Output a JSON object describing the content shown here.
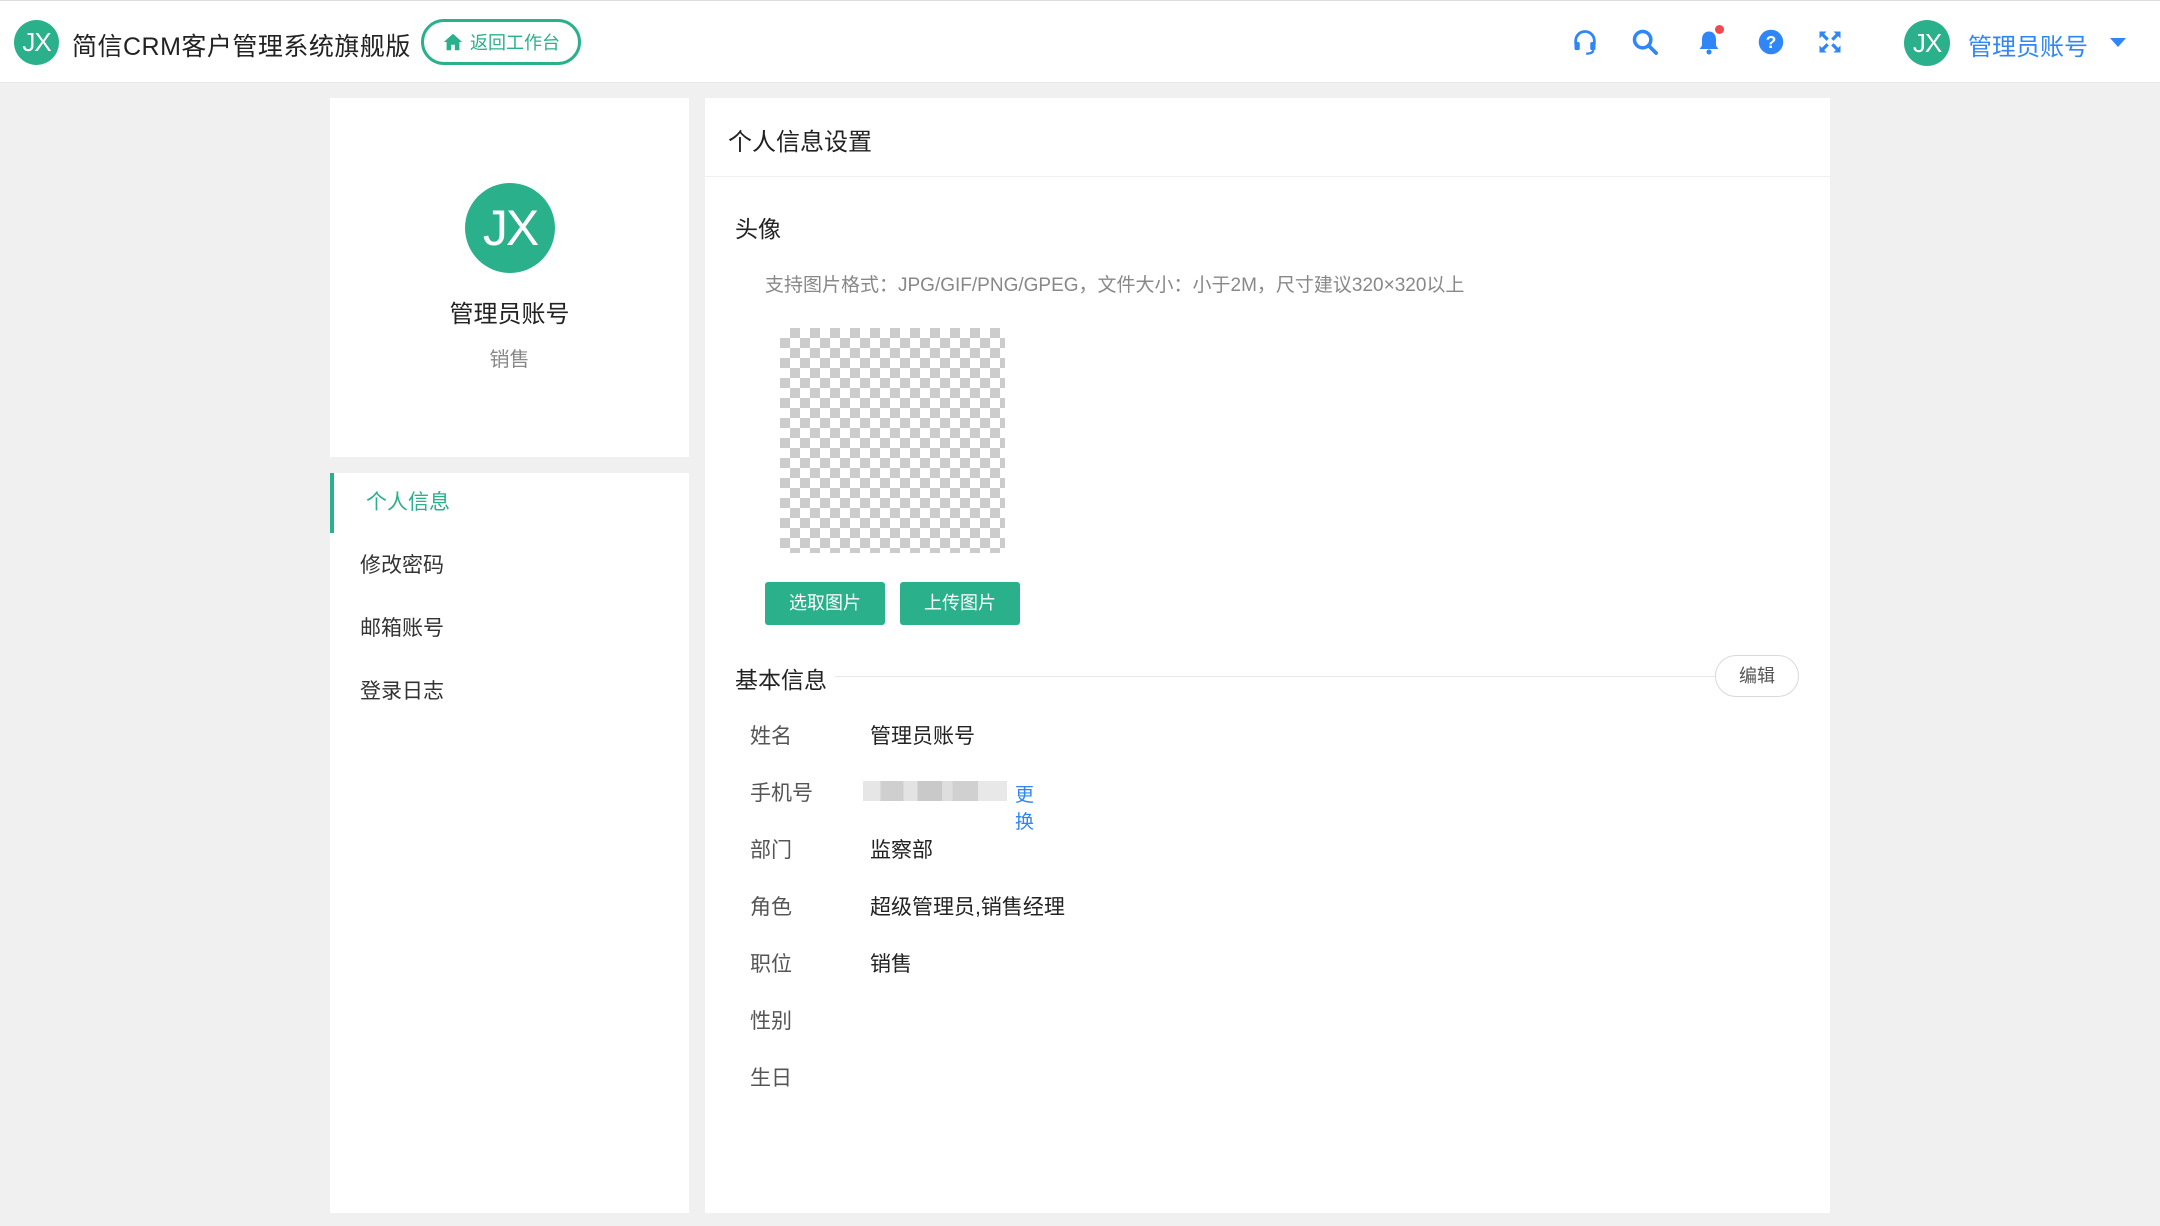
{
  "header": {
    "logo_text": "JX",
    "app_title": "简信CRM客户管理系统旗舰版",
    "back_button": "返回工作台",
    "icons": [
      "headset-icon",
      "search-icon",
      "bell-icon",
      "help-icon",
      "fullscreen-icon"
    ],
    "user_avatar_text": "JX",
    "user_name": "管理员账号",
    "accent_color": "#2bb08c",
    "link_color": "#2f86f6"
  },
  "profile": {
    "avatar_text": "JX",
    "name": "管理员账号",
    "role": "销售"
  },
  "menu": {
    "items": [
      {
        "label": "个人信息",
        "active": true
      },
      {
        "label": "修改密码",
        "active": false
      },
      {
        "label": "邮箱账号",
        "active": false
      },
      {
        "label": "登录日志",
        "active": false
      }
    ]
  },
  "main": {
    "title": "个人信息设置",
    "avatar_section": {
      "title": "头像",
      "hint": "支持图片格式：JPG/GIF/PNG/GPEG，文件大小：小于2M，尺寸建议320×320以上",
      "select_button": "选取图片",
      "upload_button": "上传图片"
    },
    "basic_section": {
      "title": "基本信息",
      "edit_button": "编辑",
      "fields": [
        {
          "label": "姓名",
          "value": "管理员账号"
        },
        {
          "label": "手机号",
          "value": "",
          "action": "更换"
        },
        {
          "label": "部门",
          "value": "监察部"
        },
        {
          "label": "角色",
          "value": "超级管理员,销售经理"
        },
        {
          "label": "职位",
          "value": "销售"
        },
        {
          "label": "性别",
          "value": ""
        },
        {
          "label": "生日",
          "value": ""
        }
      ]
    }
  }
}
